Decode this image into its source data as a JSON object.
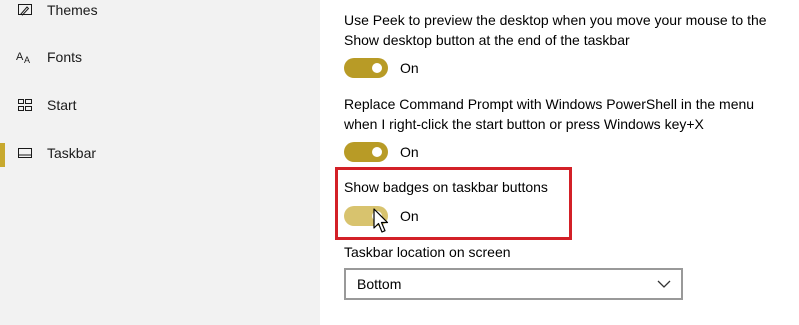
{
  "sidebar": {
    "items": [
      {
        "label": "Themes",
        "icon": "themes-icon"
      },
      {
        "label": "Fonts",
        "icon": "fonts-icon"
      },
      {
        "label": "Start",
        "icon": "start-icon"
      },
      {
        "label": "Taskbar",
        "icon": "taskbar-icon"
      }
    ]
  },
  "settings": {
    "peek": {
      "text": "Use Peek to preview the desktop when you move your mouse to the Show desktop button at the end of the taskbar",
      "state": "On"
    },
    "powershell": {
      "text": "Replace Command Prompt with Windows PowerShell in the menu when I right-click the start button or press Windows key+X",
      "state": "On"
    },
    "badges": {
      "text": "Show badges on taskbar buttons",
      "state": "On"
    },
    "location": {
      "label": "Taskbar location on screen",
      "value": "Bottom"
    }
  },
  "colors": {
    "accent": "#b89b26",
    "accent_hover": "#d8c36e",
    "highlight": "#d32027"
  }
}
